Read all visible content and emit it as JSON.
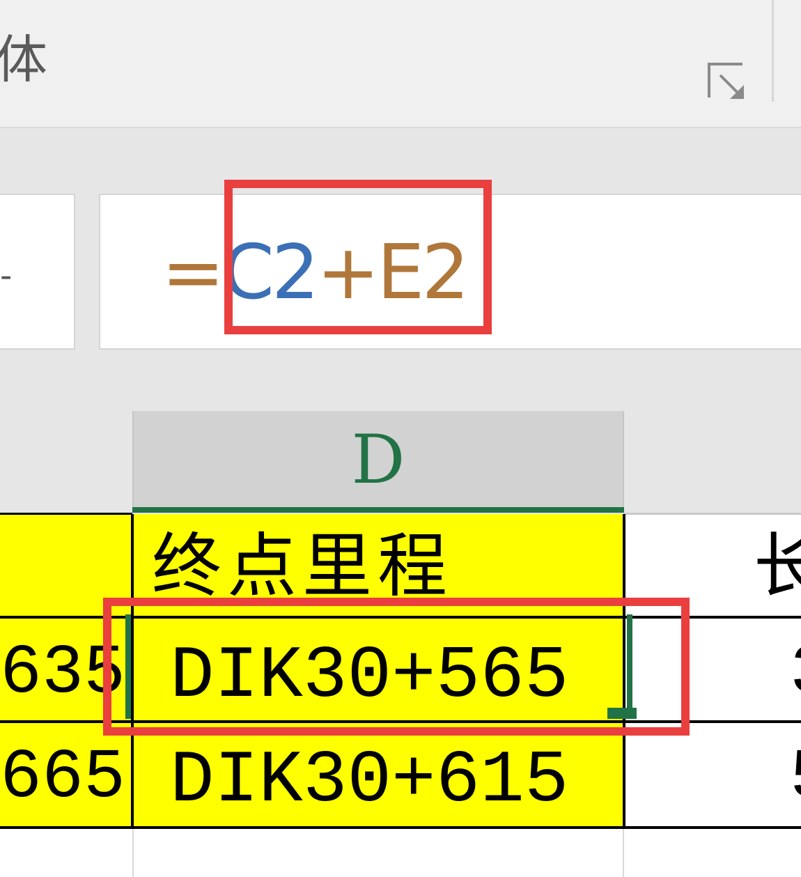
{
  "ribbon": {
    "group_label": "体",
    "launcher_icon": "dialog-launcher-icon"
  },
  "formula_bar": {
    "name_box_visible": "-",
    "formula_eq": "=",
    "formula_ref1": "C2",
    "formula_op": "+",
    "formula_ref2": "E2"
  },
  "grid": {
    "column_header": "D",
    "header_row": {
      "c_partial": "",
      "d": "终点里程",
      "e_partial": "长"
    },
    "rows": [
      {
        "c_partial": "635",
        "d": "DIK30+565",
        "e_partial": "3"
      },
      {
        "c_partial": "665",
        "d": "DIK30+615",
        "e_partial": "5"
      }
    ]
  },
  "colors": {
    "selection": "#217346",
    "highlight": "#ea3f3f",
    "cell_fill": "#ffff00",
    "ref1": "#3b6fb6",
    "ref2": "#b0773a"
  }
}
